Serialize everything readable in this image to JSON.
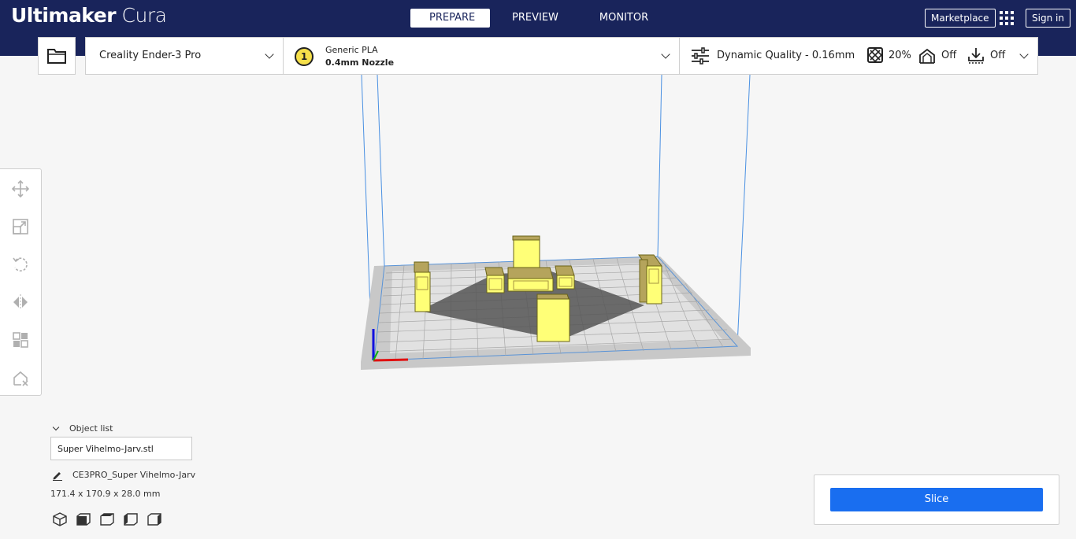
{
  "app": {
    "brand_bold": "Ultimaker",
    "brand_light": "Cura"
  },
  "stages": [
    {
      "label": "PREPARE",
      "active": true
    },
    {
      "label": "PREVIEW",
      "active": false
    },
    {
      "label": "MONITOR",
      "active": false
    }
  ],
  "header_right": {
    "marketplace": "Marketplace",
    "sign_in": "Sign in"
  },
  "printer": {
    "name": "Creality Ender-3 Pro"
  },
  "material": {
    "extruder_number": "1",
    "name": "Generic PLA",
    "nozzle": "0.4mm Nozzle"
  },
  "print_settings": {
    "quality": "Dynamic Quality - 0.16mm",
    "infill": "20%",
    "support": "Off",
    "adhesion": "Off"
  },
  "object_list": {
    "header": "Object list",
    "selected_object": "Super Vihelmo-Jarv.stl",
    "job_name": "CE3PRO_Super Vihelmo-Jarv",
    "dimensions": "171.4 x 170.9 x 28.0 mm"
  },
  "slice": {
    "button_label": "Slice"
  },
  "colors": {
    "header_bg": "#19245b",
    "accent_blue": "#196ef0",
    "model_yellow": "#ffff77",
    "build_volume_line": "#4a90e2"
  }
}
